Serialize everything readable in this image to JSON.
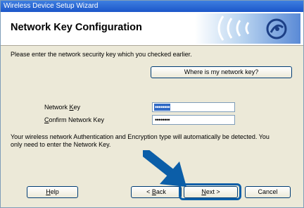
{
  "window": {
    "title": "Wireless Device Setup Wizard",
    "heading": "Network Key Configuration"
  },
  "instructions": "Please enter the network security key which you checked earlier.",
  "where_button": "Where is my network key?",
  "network_key": {
    "label_prefix": "Network ",
    "label_mnemonic": "K",
    "label_suffix": "ey",
    "masked_value": "••••••••"
  },
  "confirm_key": {
    "label_mnemonic": "C",
    "label_suffix": "onfirm Network Key",
    "masked_value": "••••••••"
  },
  "info_line1": "Your wireless network Authentication and Encryption type will automatically be detected. You",
  "info_line2": "only need to enter the Network Key.",
  "buttons": {
    "help_mnemonic": "H",
    "help_suffix": "elp",
    "back_prefix": "< ",
    "back_mnemonic": "B",
    "back_suffix": "ack",
    "next_mnemonic": "N",
    "next_suffix": "ext >",
    "cancel": "Cancel"
  },
  "colors": {
    "accent": "#0b5ea8",
    "selection": "#316ac5"
  },
  "icons": {
    "logo": "wireless-signal-icon",
    "pointer": "arrow-pointer-icon"
  }
}
